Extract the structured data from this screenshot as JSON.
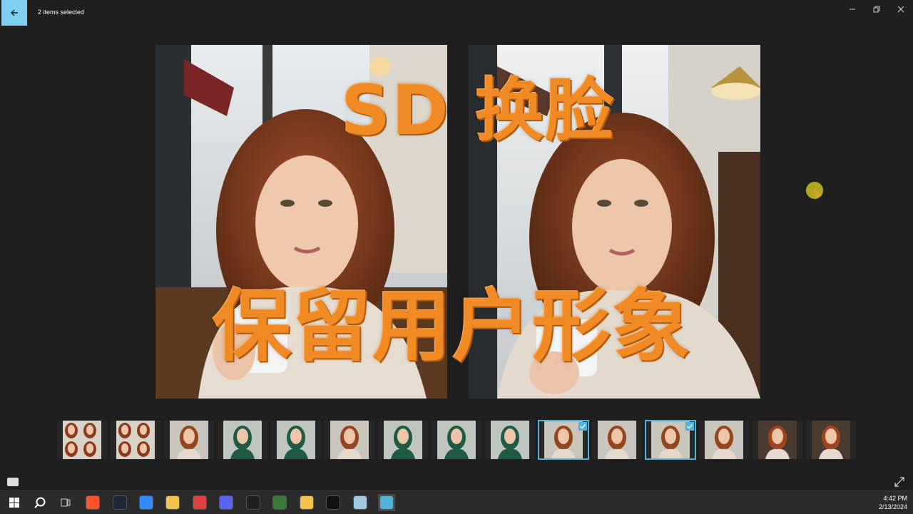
{
  "window": {
    "title": "2 items selected"
  },
  "viewer": {
    "overlay_line1": "SD 换脸",
    "overlay_line2": "保留用户形象"
  },
  "filmstrip": {
    "thumbnails": [
      {
        "kind": "grid",
        "selected": false
      },
      {
        "kind": "grid",
        "selected": false
      },
      {
        "kind": "cafe",
        "selected": false
      },
      {
        "kind": "green",
        "selected": false
      },
      {
        "kind": "green",
        "selected": false
      },
      {
        "kind": "cafe",
        "selected": false
      },
      {
        "kind": "green",
        "selected": false
      },
      {
        "kind": "green",
        "selected": false
      },
      {
        "kind": "green",
        "selected": false
      },
      {
        "kind": "cafe",
        "selected": true
      },
      {
        "kind": "cafe",
        "selected": false
      },
      {
        "kind": "cafe",
        "selected": true
      },
      {
        "kind": "cafe",
        "selected": false
      },
      {
        "kind": "portrait",
        "selected": false
      },
      {
        "kind": "portrait",
        "selected": false
      }
    ]
  },
  "taskbar": {
    "icons": [
      "windows-start-icon",
      "search-icon",
      "task-view-icon",
      "brave-icon",
      "steam-icon",
      "zoom-icon",
      "file-explorer-icon",
      "pin-app-icon",
      "discord-icon",
      "obs-icon",
      "tree-app-icon",
      "folder-app-icon",
      "terminal-icon",
      "notepad-icon",
      "photos-icon"
    ],
    "time": "4:42 PM",
    "date": "2/13/2024"
  },
  "colors": {
    "accent": "#4fb3d9",
    "back_button": "#7fd0f0",
    "overlay_text": "#f08a24",
    "background": "#1f1f1f"
  }
}
